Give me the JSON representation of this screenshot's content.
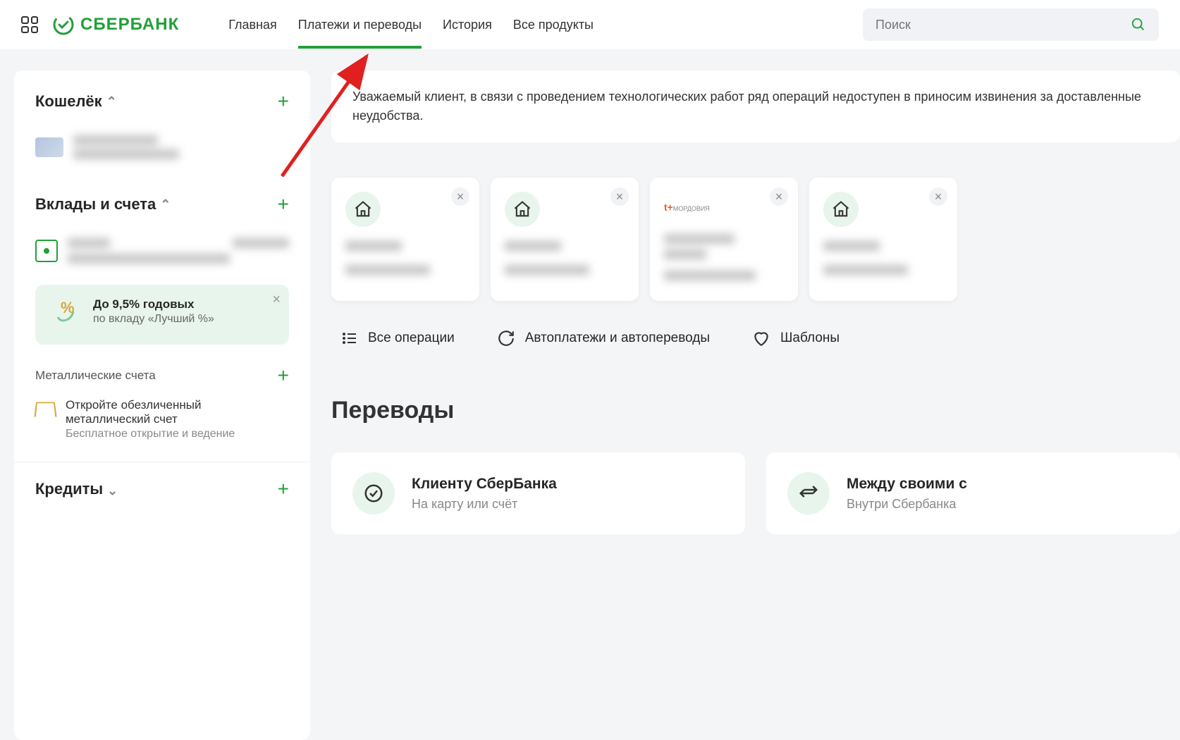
{
  "header": {
    "logo_text": "СБЕРБАНК",
    "nav": [
      "Главная",
      "Платежи и переводы",
      "История",
      "Все продукты"
    ],
    "active_index": 1,
    "search_placeholder": "Поиск"
  },
  "sidebar": {
    "wallet": {
      "title": "Кошелёк"
    },
    "deposits": {
      "title": "Вклады и счета"
    },
    "promo": {
      "title": "До 9,5% годовых",
      "subtitle": "по вкладу «Лучший %»"
    },
    "metal": {
      "section_title": "Металлические счета",
      "open_title": "Откройте обезличенный металлический счет",
      "open_sub": "Бесплатное открытие и ведение"
    },
    "credits": {
      "title": "Кредиты"
    }
  },
  "main": {
    "alert": "Уважаемый клиент, в связи с проведением технологических работ ряд операций недоступен в приносим извинения за доставленные неудобства.",
    "tile_logo_text": "t+",
    "tile_logo_sub": "МОРДОВИЯ",
    "quick_links": [
      "Все операции",
      "Автоплатежи и автопереводы",
      "Шаблоны"
    ],
    "transfers_heading": "Переводы",
    "transfer_cards": [
      {
        "title": "Клиенту СберБанка",
        "sub": "На карту или счёт"
      },
      {
        "title": "Между своими с",
        "sub": "Внутри Сбербанка"
      }
    ]
  }
}
